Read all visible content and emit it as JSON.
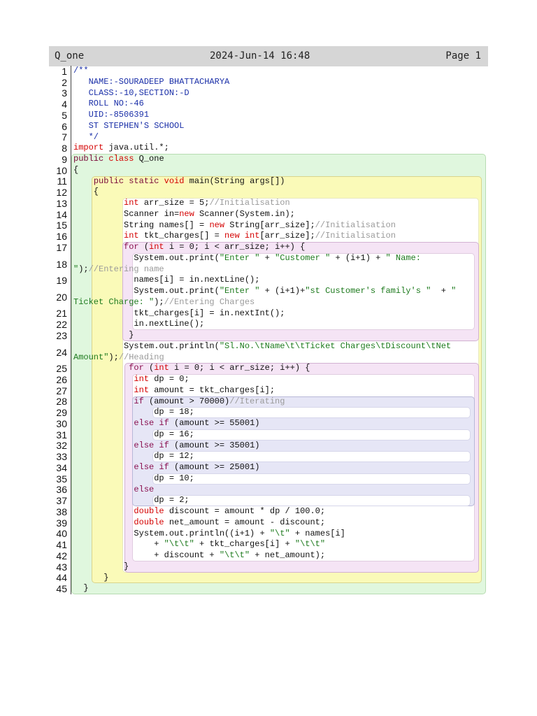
{
  "header": {
    "title": "Q_one",
    "datetime": "2024-Jun-14 16:48",
    "page": "Page 1"
  },
  "lines": [
    {
      "n": "1",
      "rows": [
        [
          [
            "d",
            "/**"
          ]
        ]
      ]
    },
    {
      "n": "2",
      "rows": [
        [
          [
            "d",
            "   NAME:-SOURADEEP BHATTACHARYA"
          ]
        ]
      ]
    },
    {
      "n": "3",
      "rows": [
        [
          [
            "d",
            "   CLASS:-10,SECTION:-D"
          ]
        ]
      ]
    },
    {
      "n": "4",
      "rows": [
        [
          [
            "d",
            "   ROLL NO:-46"
          ]
        ]
      ]
    },
    {
      "n": "5",
      "rows": [
        [
          [
            "d",
            "   UID:-8506391"
          ]
        ]
      ]
    },
    {
      "n": "6",
      "rows": [
        [
          [
            "d",
            "   ST STEPHEN'S SCHOOL"
          ]
        ]
      ]
    },
    {
      "n": "7",
      "rows": [
        [
          [
            "d",
            "   */"
          ]
        ]
      ]
    },
    {
      "n": "8",
      "rows": [
        [
          [
            "k",
            "import"
          ],
          [
            "p",
            " java.util.*;"
          ]
        ]
      ]
    },
    {
      "n": "9",
      "rows": [
        [
          [
            "m",
            "public"
          ],
          [
            "p",
            " "
          ],
          [
            "k",
            "class"
          ],
          [
            "p",
            " Q_one"
          ]
        ]
      ]
    },
    {
      "n": "10",
      "rows": [
        [
          [
            "p",
            "{"
          ]
        ]
      ]
    },
    {
      "n": "11",
      "rows": [
        [
          [
            "p",
            "    "
          ],
          [
            "m",
            "public static"
          ],
          [
            "p",
            " "
          ],
          [
            "k",
            "void"
          ],
          [
            "p",
            " main(String args[])"
          ]
        ]
      ]
    },
    {
      "n": "12",
      "rows": [
        [
          [
            "p",
            "    {"
          ]
        ]
      ]
    },
    {
      "n": "13",
      "rows": [
        [
          [
            "p",
            "          "
          ],
          [
            "k",
            "int"
          ],
          [
            "p",
            " arr_size = 5;"
          ],
          [
            "cm",
            "//Initialisation"
          ]
        ]
      ]
    },
    {
      "n": "14",
      "rows": [
        [
          [
            "p",
            "          Scanner in="
          ],
          [
            "k",
            "new"
          ],
          [
            "p",
            " Scanner(System.in);"
          ]
        ]
      ]
    },
    {
      "n": "15",
      "rows": [
        [
          [
            "p",
            "          String names[] = "
          ],
          [
            "k",
            "new"
          ],
          [
            "p",
            " String[arr_size];"
          ],
          [
            "cm",
            "//Initialisation"
          ]
        ]
      ]
    },
    {
      "n": "16",
      "rows": [
        [
          [
            "p",
            "          "
          ],
          [
            "k",
            "int"
          ],
          [
            "p",
            " tkt_charges[] = "
          ],
          [
            "k",
            "new"
          ],
          [
            "p",
            " "
          ],
          [
            "k",
            "int"
          ],
          [
            "p",
            "[arr_size];"
          ],
          [
            "cm",
            "//Initialisation"
          ]
        ]
      ]
    },
    {
      "n": "17",
      "rows": [
        [
          [
            "p",
            "          "
          ],
          [
            "c",
            "for"
          ],
          [
            "p",
            " ("
          ],
          [
            "k",
            "int"
          ],
          [
            "p",
            " i = 0; i < arr_size; i++) {"
          ]
        ]
      ]
    },
    {
      "n": "18",
      "rows": [
        [
          [
            "p",
            "            System.out.print("
          ],
          [
            "s",
            "\"Enter \""
          ],
          [
            "p",
            " + "
          ],
          [
            "s",
            "\"Customer \""
          ],
          [
            "p",
            " + (i+1) + "
          ],
          [
            "s",
            "\" Name:"
          ]
        ],
        [
          [
            "s",
            "\""
          ],
          [
            "p",
            ");"
          ],
          [
            "cm",
            "//Entering name"
          ]
        ]
      ]
    },
    {
      "n": "19",
      "rows": [
        [
          [
            "p",
            "            names[i] = in.nextLine();"
          ]
        ]
      ]
    },
    {
      "n": "20",
      "rows": [
        [
          [
            "p",
            "            System.out.print("
          ],
          [
            "s",
            "\"Enter \""
          ],
          [
            "p",
            " + (i+1)+"
          ],
          [
            "s",
            "\"st Customer's family's \""
          ],
          [
            "p",
            "  + "
          ],
          [
            "s",
            "\""
          ]
        ],
        [
          [
            "s",
            "Ticket Charge: \""
          ],
          [
            "p",
            ");"
          ],
          [
            "cm",
            "//Entering Charges"
          ]
        ]
      ]
    },
    {
      "n": "21",
      "rows": [
        [
          [
            "p",
            "            tkt_charges[i] = in.nextInt();"
          ]
        ]
      ]
    },
    {
      "n": "22",
      "rows": [
        [
          [
            "p",
            "            in.nextLine();"
          ]
        ]
      ]
    },
    {
      "n": "23",
      "rows": [
        [
          [
            "p",
            "           }"
          ]
        ]
      ]
    },
    {
      "n": "24",
      "rows": [
        [
          [
            "p",
            "          System.out.println("
          ],
          [
            "s",
            "\"Sl.No.\\tName\\t\\tTicket Charges\\tDiscount\\tNet"
          ]
        ],
        [
          [
            "s",
            "Amount\""
          ],
          [
            "p",
            ");"
          ],
          [
            "cm",
            "//Heading"
          ]
        ]
      ]
    },
    {
      "n": "25",
      "rows": [
        [
          [
            "p",
            "           "
          ],
          [
            "c",
            "for"
          ],
          [
            "p",
            " ("
          ],
          [
            "k",
            "int"
          ],
          [
            "p",
            " i = 0; i < arr_size; i++) {"
          ]
        ]
      ]
    },
    {
      "n": "26",
      "rows": [
        [
          [
            "p",
            "            "
          ],
          [
            "k",
            "int"
          ],
          [
            "p",
            " dp = 0;"
          ]
        ]
      ]
    },
    {
      "n": "27",
      "rows": [
        [
          [
            "p",
            "            "
          ],
          [
            "k",
            "int"
          ],
          [
            "p",
            " amount = tkt_charges[i];"
          ]
        ]
      ]
    },
    {
      "n": "28",
      "rows": [
        [
          [
            "p",
            "            "
          ],
          [
            "c",
            "if"
          ],
          [
            "p",
            " (amount > 70000)"
          ],
          [
            "cm",
            "//Iterating"
          ]
        ]
      ]
    },
    {
      "n": "29",
      "rows": [
        [
          [
            "p",
            "                dp = 18;"
          ]
        ]
      ]
    },
    {
      "n": "30",
      "rows": [
        [
          [
            "p",
            "            "
          ],
          [
            "c",
            "else if"
          ],
          [
            "p",
            " (amount >= 55001)"
          ]
        ]
      ]
    },
    {
      "n": "31",
      "rows": [
        [
          [
            "p",
            "                dp = 16;"
          ]
        ]
      ]
    },
    {
      "n": "32",
      "rows": [
        [
          [
            "p",
            "            "
          ],
          [
            "c",
            "else if"
          ],
          [
            "p",
            " (amount >= 35001)"
          ]
        ]
      ]
    },
    {
      "n": "33",
      "rows": [
        [
          [
            "p",
            "                dp = 12;"
          ]
        ]
      ]
    },
    {
      "n": "34",
      "rows": [
        [
          [
            "p",
            "            "
          ],
          [
            "c",
            "else if"
          ],
          [
            "p",
            " (amount >= 25001)"
          ]
        ]
      ]
    },
    {
      "n": "35",
      "rows": [
        [
          [
            "p",
            "                dp = 10;"
          ]
        ]
      ]
    },
    {
      "n": "36",
      "rows": [
        [
          [
            "p",
            "            "
          ],
          [
            "c",
            "else"
          ]
        ]
      ]
    },
    {
      "n": "37",
      "rows": [
        [
          [
            "p",
            "                dp = 2;"
          ]
        ]
      ]
    },
    {
      "n": "38",
      "rows": [
        [
          [
            "p",
            "            "
          ],
          [
            "k",
            "double"
          ],
          [
            "p",
            " discount = amount * dp / 100.0;"
          ]
        ]
      ]
    },
    {
      "n": "39",
      "rows": [
        [
          [
            "p",
            "            "
          ],
          [
            "k",
            "double"
          ],
          [
            "p",
            " net_amount = amount - discount;"
          ]
        ]
      ]
    },
    {
      "n": "40",
      "rows": [
        [
          [
            "p",
            "            System.out.println((i+1) + "
          ],
          [
            "s",
            "\"\\t\""
          ],
          [
            "p",
            " + names[i]"
          ]
        ]
      ]
    },
    {
      "n": "41",
      "rows": [
        [
          [
            "p",
            "                + "
          ],
          [
            "s",
            "\"\\t\\t\""
          ],
          [
            "p",
            " + tkt_charges[i] + "
          ],
          [
            "s",
            "\"\\t\\t\""
          ]
        ]
      ]
    },
    {
      "n": "42",
      "rows": [
        [
          [
            "p",
            "                + discount + "
          ],
          [
            "s",
            "\"\\t\\t\""
          ],
          [
            "p",
            " + net_amount);"
          ]
        ]
      ]
    },
    {
      "n": "43",
      "rows": [
        [
          [
            "p",
            "          }"
          ]
        ]
      ]
    },
    {
      "n": "44",
      "rows": [
        [
          [
            "p",
            "      }"
          ]
        ]
      ]
    },
    {
      "n": "45",
      "rows": [
        [
          [
            "p",
            "  }"
          ]
        ]
      ]
    }
  ],
  "colors": {
    "class_scope": "#e0f7de",
    "method_scope": "#fafab8",
    "loop_scope": "#f5e4f5",
    "if_scope": "#e6e6f6",
    "body": "#ffffff"
  }
}
